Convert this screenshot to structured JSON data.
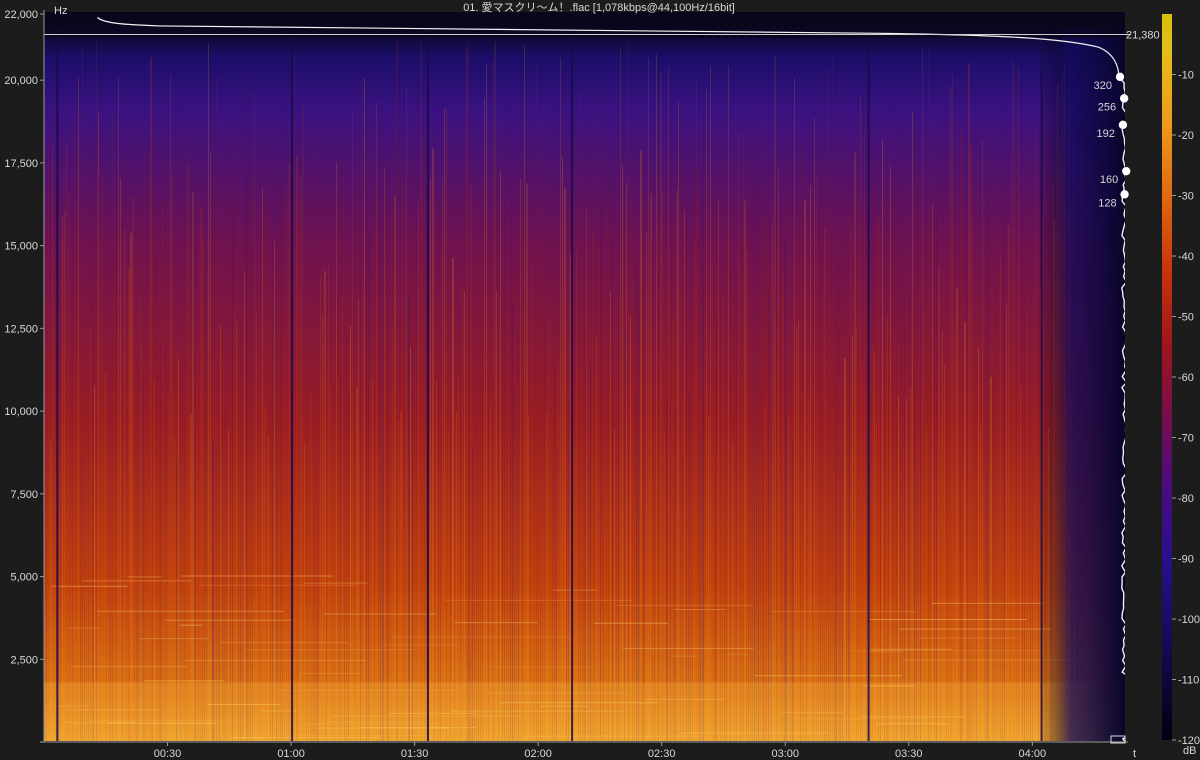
{
  "window": {
    "title": "01. 愛マスクリ〜ム！.flac [1,078kbps@44,100Hz/16bit]"
  },
  "chart_data": {
    "type": "heatmap",
    "title": "01. 愛マスクリ〜ム！.flac [1,078kbps@44,100Hz/16bit]",
    "file": "01. 愛マスクリ〜ム！.flac",
    "format": "1,078kbps@44,100Hz/16bit",
    "xlabel": "t",
    "ylabel": "Hz",
    "colorbar_label": "dB",
    "duration_seconds": 283,
    "xlim": [
      0,
      283
    ],
    "ylim": [
      0,
      22050
    ],
    "x_ticks": [
      {
        "t": 30,
        "label": "00:30"
      },
      {
        "t": 60,
        "label": "01:00"
      },
      {
        "t": 90,
        "label": "01:30"
      },
      {
        "t": 120,
        "label": "02:00"
      },
      {
        "t": 150,
        "label": "02:30"
      },
      {
        "t": 180,
        "label": "03:00"
      },
      {
        "t": 210,
        "label": "03:30"
      },
      {
        "t": 240,
        "label": "04:00"
      }
    ],
    "y_ticks": [
      {
        "hz": 2500,
        "label": "2,500"
      },
      {
        "hz": 5000,
        "label": "5,000"
      },
      {
        "hz": 7500,
        "label": "7,500"
      },
      {
        "hz": 10000,
        "label": "10,000"
      },
      {
        "hz": 12500,
        "label": "12,500"
      },
      {
        "hz": 15000,
        "label": "15,000"
      },
      {
        "hz": 17500,
        "label": "17,500"
      },
      {
        "hz": 20000,
        "label": "20,000"
      },
      {
        "hz": 22000,
        "label": "22,000"
      }
    ],
    "db_ticks": [
      {
        "db": -10,
        "label": "-10"
      },
      {
        "db": -20,
        "label": "-20"
      },
      {
        "db": -30,
        "label": "-30"
      },
      {
        "db": -40,
        "label": "-40"
      },
      {
        "db": -50,
        "label": "-50"
      },
      {
        "db": -60,
        "label": "-60"
      },
      {
        "db": -70,
        "label": "-70"
      },
      {
        "db": -80,
        "label": "-80"
      },
      {
        "db": -90,
        "label": "-90"
      },
      {
        "db": -100,
        "label": "-100"
      },
      {
        "db": -110,
        "label": "-110"
      },
      {
        "db": -120,
        "label": "-120"
      }
    ],
    "db_range": [
      -120,
      0
    ],
    "cutoff": {
      "hz": 21380,
      "label": "21,380"
    },
    "bitrate_markers": [
      {
        "label": "320",
        "hz": 20100
      },
      {
        "label": "256",
        "hz": 19450
      },
      {
        "label": "192",
        "hz": 18650
      },
      {
        "label": "160",
        "hz": 17250
      },
      {
        "label": "128",
        "hz": 16550
      }
    ],
    "colorscale": [
      "#000010",
      "#1a0a5e",
      "#2a0f8c",
      "#5a0a78",
      "#8a0d3a",
      "#b01c0c",
      "#d44a08",
      "#eb7a12",
      "#f4a41e",
      "#e8c21a",
      "#d8c00c"
    ],
    "quiet_moments_seconds": [
      3,
      60,
      93,
      128,
      200,
      242
    ],
    "grid": true
  }
}
